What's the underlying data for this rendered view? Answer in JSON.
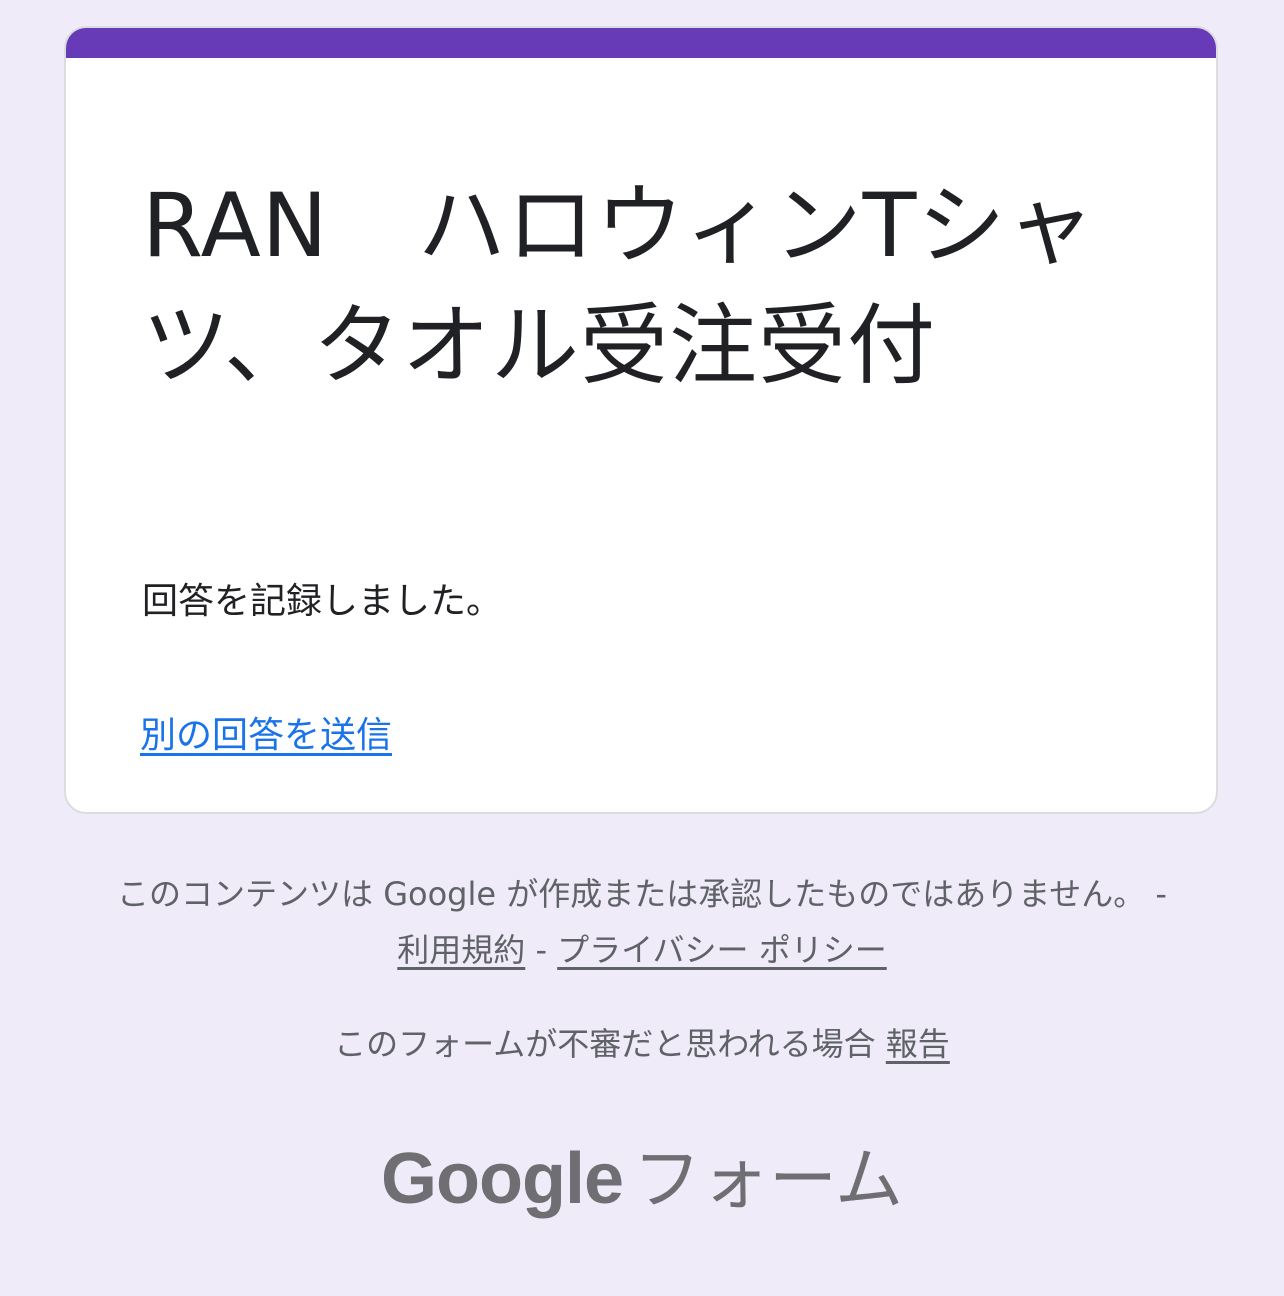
{
  "form": {
    "title": "RAN　ハロウィンTシャツ、タオル受注受付",
    "confirmation_message": "回答を記録しました。",
    "another_response_link": "別の回答を送信"
  },
  "footer": {
    "disclaimer_text": "このコンテンツは Google が作成または承認したものではありません。",
    "separator": " - ",
    "terms_link": "利用規約",
    "privacy_link": "プライバシー ポリシー",
    "report_text": "このフォームが不審だと思われる場合 ",
    "report_link": "報告"
  },
  "branding": {
    "google": "Google",
    "forms": "フォーム"
  },
  "colors": {
    "accent": "#673ab7",
    "background": "#efebf8",
    "link": "#1a73e8",
    "text": "#202124",
    "muted": "#5f6368"
  }
}
